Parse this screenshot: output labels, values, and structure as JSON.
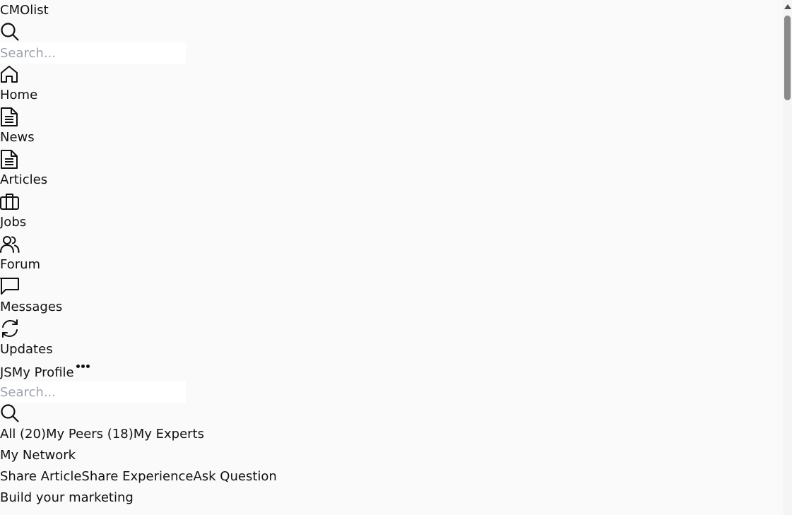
{
  "brand": {
    "name": "CMOlist"
  },
  "top_search": {
    "placeholder": "Search..."
  },
  "nav": {
    "home": {
      "label": "Home",
      "icon": "home-icon"
    },
    "news": {
      "label": "News",
      "icon": "document-icon"
    },
    "articles": {
      "label": "Articles",
      "icon": "document-icon"
    },
    "jobs": {
      "label": "Jobs",
      "icon": "briefcase-icon"
    },
    "forum": {
      "label": "Forum",
      "icon": "users-icon"
    },
    "messages": {
      "label": "Messages",
      "icon": "chat-icon"
    },
    "updates": {
      "label": "Updates",
      "icon": "refresh-icon"
    }
  },
  "profile": {
    "initials": "JS",
    "label": "My Profile",
    "more_icon": "more-dots-icon"
  },
  "network_search": {
    "placeholder": "Search..."
  },
  "filters": {
    "all": "All (20)",
    "peers": "My Peers (18)",
    "experts": "My Experts"
  },
  "network": {
    "title": "My Network"
  },
  "actions": {
    "share_article": "Share Article",
    "share_experience": "Share Experience",
    "ask_question": "Ask Question"
  },
  "feed": {
    "teaser": "Build your marketing"
  },
  "colors": {
    "background": "#fafafa",
    "text": "#111111",
    "placeholder": "#9ca3af",
    "scroll_thumb": "#8a8a8a"
  }
}
